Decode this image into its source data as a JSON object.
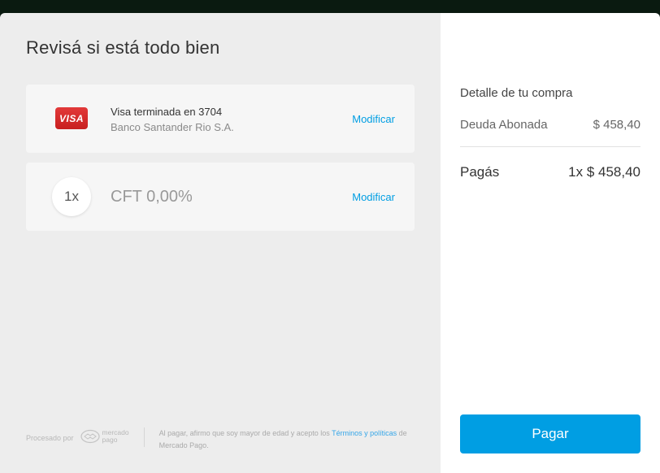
{
  "review": {
    "title": "Revisá si está todo bien",
    "payment_method": {
      "brand_label": "VISA",
      "name": "Visa terminada en 3704",
      "bank": "Banco Santander Rio S.A.",
      "modify_label": "Modificar"
    },
    "installments": {
      "count_label": "1x",
      "cft_label": "CFT 0,00%",
      "modify_label": "Modificar"
    }
  },
  "footer": {
    "processed_by": "Procesado por",
    "logo_line1": "mercado",
    "logo_line2": "pago",
    "legal_text": "Al pagar, afirmo que soy mayor de edad y acepto los ",
    "legal_link": "Términos y políticas",
    "legal_suffix": " de Mercado Pago."
  },
  "summary": {
    "title": "Detalle de tu compra",
    "debt_label": "Deuda Abonada",
    "debt_amount": "$ 458,40",
    "total_label": "Pagás",
    "total_amount": "1x $ 458,40",
    "pay_button": "Pagar"
  },
  "colors": {
    "accent": "#009ee3",
    "visa_red": "#d22a2a",
    "left_bg": "#ededed",
    "card_bg": "#f6f6f6"
  }
}
